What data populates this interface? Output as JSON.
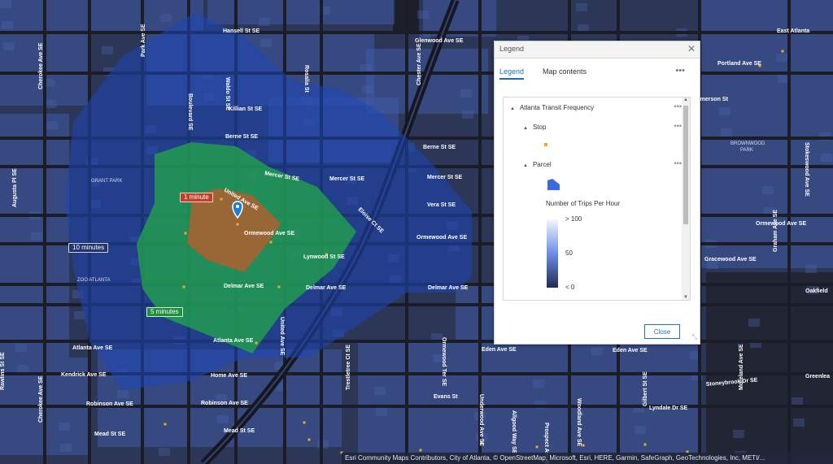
{
  "map": {
    "street_labels": [
      {
        "text": "Hansell St SE"
      },
      {
        "text": "Glenwood Ave SE"
      },
      {
        "text": "Killian St SE"
      },
      {
        "text": "Berne St SE"
      },
      {
        "text": "Mercer St SE"
      },
      {
        "text": "Mercer St SE"
      },
      {
        "text": "Mercer St SE"
      },
      {
        "text": "Berne St SE"
      },
      {
        "text": "United Ave SE"
      },
      {
        "text": "Ormewood Ave SE"
      },
      {
        "text": "Eloise Ct SE"
      },
      {
        "text": "Vera St SE"
      },
      {
        "text": "Ormewood Ave SE"
      },
      {
        "text": "Lynwood St SE"
      },
      {
        "text": "Delmar Ave SE"
      },
      {
        "text": "Delmar Ave SE"
      },
      {
        "text": "Delmar Ave SE"
      },
      {
        "text": "Atlanta Ave SE"
      },
      {
        "text": "Atlanta Ave SE"
      },
      {
        "text": "Kendrick Ave SE"
      },
      {
        "text": "Home Ave SE"
      },
      {
        "text": "Robinson Ave SE"
      },
      {
        "text": "Robinson Ave SE"
      },
      {
        "text": "Mead St SE"
      },
      {
        "text": "Mead St SE"
      },
      {
        "text": "Eden Ave SE"
      },
      {
        "text": "Eden Ave SE"
      },
      {
        "text": "Evans St"
      },
      {
        "text": "Stoneybrook Dr SE"
      },
      {
        "text": "Lyndale Dr SE"
      },
      {
        "text": "Portland Ave SE"
      },
      {
        "text": "Emerson St"
      },
      {
        "text": "Ormewood Ave SE"
      },
      {
        "text": "Gracewood Ave SE"
      },
      {
        "text": "East Atlanta"
      },
      {
        "text": "Oakfield"
      },
      {
        "text": "Greenlea"
      },
      {
        "text": "Boulevard SE"
      },
      {
        "text": "Waldo St SE"
      },
      {
        "text": "Park Ave SE"
      },
      {
        "text": "Rosalia St"
      },
      {
        "text": "Chester Ave SE"
      },
      {
        "text": "Cherokee Ave SE"
      },
      {
        "text": "Augusta Pl SE"
      },
      {
        "text": "United Ave SE"
      },
      {
        "text": "Ormewood Ter SE"
      },
      {
        "text": "Trestletree Ct SE"
      },
      {
        "text": "Underwood Ave SE"
      },
      {
        "text": "Woodland Ave SE"
      },
      {
        "text": "Gilbert St SE"
      },
      {
        "text": "Moreland Ave SE"
      },
      {
        "text": "Graham Ave SE"
      },
      {
        "text": "Stokeswood Ave SE"
      },
      {
        "text": "Allgood Way SE"
      },
      {
        "text": "Prospect Ave SE"
      },
      {
        "text": "Rawlins St SE"
      },
      {
        "text": "Cherokee Ave SE"
      }
    ],
    "place_labels": [
      {
        "text": "GRANT PARK"
      },
      {
        "text": "ZOO ATLANTA"
      },
      {
        "text": "BROWNWOOD"
      },
      {
        "text": "PARK"
      }
    ],
    "isochrones": {
      "ten_minutes": "10 minutes",
      "five_minutes": "5 minutes",
      "one_minute": "1 minute"
    },
    "colors": {
      "background": "#2c3656",
      "parcel_fill": "#3f5aa6",
      "isochrone_10": "#1e46b8",
      "isochrone_5": "#22a847",
      "isochrone_1": "#c25a2a",
      "stop": "#f0a830",
      "location_pin": "#1f7fd6"
    },
    "pin_icon": "map-pin-icon",
    "attribution": "Esri Community Maps Contributors, City of Atlanta, © OpenStreetMap, Microsoft, Esri, HERE, Garmin, SafeGraph, GeoTechnologies, Inc, METI/..."
  },
  "legend": {
    "title": "Legend",
    "close_icon": "close-icon",
    "tabs": [
      {
        "label": "Legend"
      },
      {
        "label": "Map contents"
      }
    ],
    "more_label": "•••",
    "layer": "Atlanta Transit Frequency",
    "sublayers": [
      {
        "label": "Stop"
      },
      {
        "label": "Parcel"
      }
    ],
    "ramp_title": "Number of Trips Per Hour",
    "ramp_labels": [
      "> 100",
      "50",
      "< 0"
    ],
    "close_label": "Close"
  }
}
